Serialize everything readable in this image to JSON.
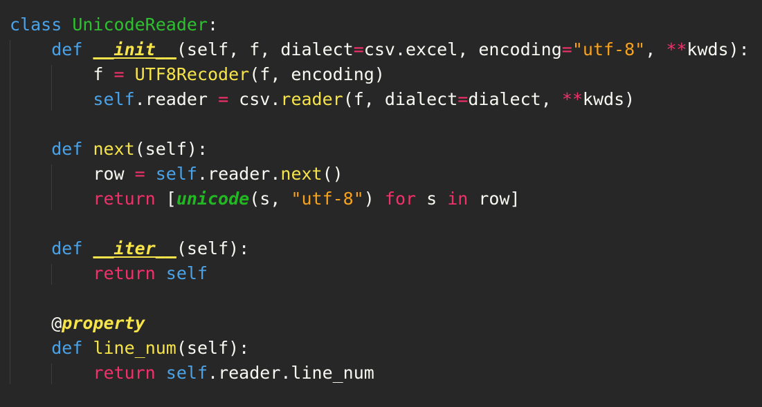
{
  "editor": {
    "theme_colors": {
      "background": "#272727",
      "keyword_blue": "#4aa3e8",
      "class_name": "#2ec02e",
      "function_name": "#f6e44a",
      "operator": "#f2306a",
      "string": "#f7a11d",
      "text": "#f8f8f2"
    },
    "lines": [
      {
        "tokens": [
          {
            "t": "class",
            "c": "kw-blue"
          },
          {
            "t": " ",
            "c": "plain"
          },
          {
            "t": "UnicodeReader",
            "c": "cls"
          },
          {
            "t": ":",
            "c": "plain"
          }
        ]
      },
      {
        "tokens": [
          {
            "t": "    ",
            "c": "plain"
          },
          {
            "t": "def",
            "c": "kw-blue"
          },
          {
            "t": " ",
            "c": "plain"
          },
          {
            "t": "__init__",
            "c": "fn-em"
          },
          {
            "t": "(self, f, dialect",
            "c": "plain"
          },
          {
            "t": "=",
            "c": "op"
          },
          {
            "t": "csv.excel, encoding",
            "c": "plain"
          },
          {
            "t": "=",
            "c": "op"
          },
          {
            "t": "\"utf-8\"",
            "c": "str"
          },
          {
            "t": ", ",
            "c": "plain"
          },
          {
            "t": "**",
            "c": "op"
          },
          {
            "t": "kwds):",
            "c": "plain"
          }
        ]
      },
      {
        "tokens": [
          {
            "t": "        f ",
            "c": "plain"
          },
          {
            "t": "=",
            "c": "op"
          },
          {
            "t": " ",
            "c": "plain"
          },
          {
            "t": "UTF8Recoder",
            "c": "fn"
          },
          {
            "t": "(f, encoding)",
            "c": "plain"
          }
        ]
      },
      {
        "tokens": [
          {
            "t": "        ",
            "c": "plain"
          },
          {
            "t": "self",
            "c": "kw-blue"
          },
          {
            "t": ".reader ",
            "c": "plain"
          },
          {
            "t": "=",
            "c": "op"
          },
          {
            "t": " csv.",
            "c": "plain"
          },
          {
            "t": "reader",
            "c": "fn"
          },
          {
            "t": "(f, dialect",
            "c": "plain"
          },
          {
            "t": "=",
            "c": "op"
          },
          {
            "t": "dialect, ",
            "c": "plain"
          },
          {
            "t": "**",
            "c": "op"
          },
          {
            "t": "kwds)",
            "c": "plain"
          }
        ]
      },
      {
        "tokens": []
      },
      {
        "tokens": [
          {
            "t": "    ",
            "c": "plain"
          },
          {
            "t": "def",
            "c": "kw-blue"
          },
          {
            "t": " ",
            "c": "plain"
          },
          {
            "t": "next",
            "c": "fn"
          },
          {
            "t": "(self):",
            "c": "plain"
          }
        ]
      },
      {
        "tokens": [
          {
            "t": "        row ",
            "c": "plain"
          },
          {
            "t": "=",
            "c": "op"
          },
          {
            "t": " ",
            "c": "plain"
          },
          {
            "t": "self",
            "c": "kw-blue"
          },
          {
            "t": ".reader.",
            "c": "plain"
          },
          {
            "t": "next",
            "c": "fn"
          },
          {
            "t": "()",
            "c": "plain"
          }
        ]
      },
      {
        "tokens": [
          {
            "t": "        ",
            "c": "plain"
          },
          {
            "t": "return",
            "c": "kw-red"
          },
          {
            "t": " [",
            "c": "plain"
          },
          {
            "t": "unicode",
            "c": "builtin"
          },
          {
            "t": "(s, ",
            "c": "plain"
          },
          {
            "t": "\"utf-8\"",
            "c": "str"
          },
          {
            "t": ") ",
            "c": "plain"
          },
          {
            "t": "for",
            "c": "kw-red"
          },
          {
            "t": " s ",
            "c": "plain"
          },
          {
            "t": "in",
            "c": "kw-red"
          },
          {
            "t": " row]",
            "c": "plain"
          }
        ]
      },
      {
        "tokens": []
      },
      {
        "tokens": [
          {
            "t": "    ",
            "c": "plain"
          },
          {
            "t": "def",
            "c": "kw-blue"
          },
          {
            "t": " ",
            "c": "plain"
          },
          {
            "t": "__iter__",
            "c": "fn-em"
          },
          {
            "t": "(self):",
            "c": "plain"
          }
        ]
      },
      {
        "tokens": [
          {
            "t": "        ",
            "c": "plain"
          },
          {
            "t": "return",
            "c": "kw-red"
          },
          {
            "t": " ",
            "c": "plain"
          },
          {
            "t": "self",
            "c": "kw-blue"
          }
        ]
      },
      {
        "tokens": []
      },
      {
        "tokens": [
          {
            "t": "    @",
            "c": "plain"
          },
          {
            "t": "property",
            "c": "fn-em-nu"
          }
        ]
      },
      {
        "tokens": [
          {
            "t": "    ",
            "c": "plain"
          },
          {
            "t": "def",
            "c": "kw-blue"
          },
          {
            "t": " ",
            "c": "plain"
          },
          {
            "t": "line_num",
            "c": "fn"
          },
          {
            "t": "(self):",
            "c": "plain"
          }
        ]
      },
      {
        "tokens": [
          {
            "t": "        ",
            "c": "plain"
          },
          {
            "t": "return",
            "c": "kw-red"
          },
          {
            "t": " ",
            "c": "plain"
          },
          {
            "t": "self",
            "c": "kw-blue"
          },
          {
            "t": ".reader.line_num",
            "c": "plain"
          }
        ]
      }
    ]
  }
}
